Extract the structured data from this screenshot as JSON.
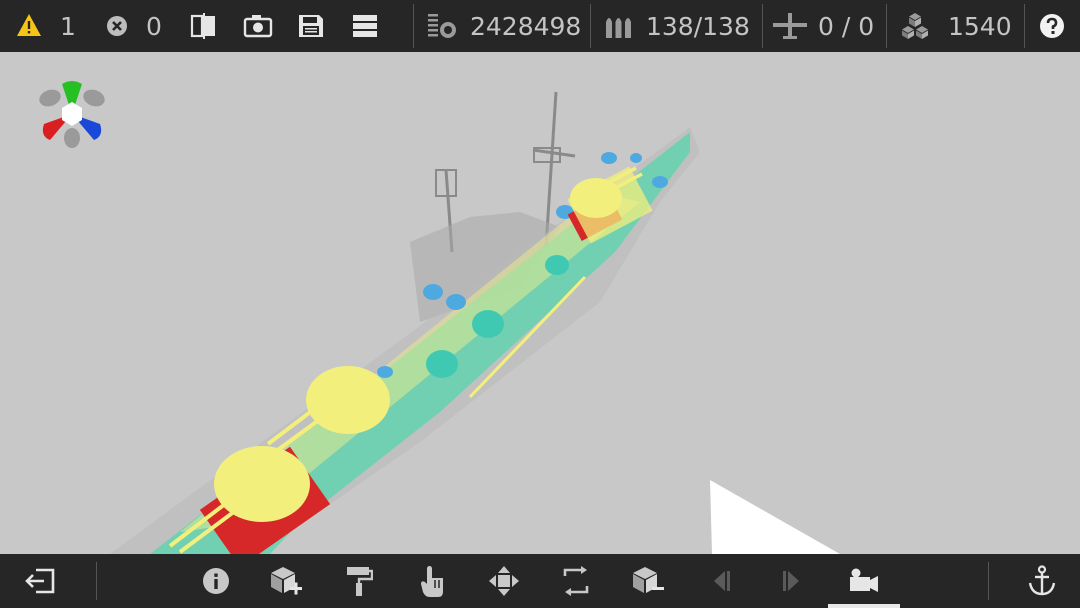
{
  "topbar": {
    "warnings": "1",
    "errors": "0",
    "points": "2428498",
    "ammo": "138/138",
    "planes": "0 / 0",
    "parts": "1540"
  },
  "icons": {
    "warning": "warning-triangle-icon",
    "error": "close-circle-icon",
    "compare": "compare-icon",
    "screenshot": "camera-icon",
    "save": "save-icon",
    "menu": "menu-icon",
    "points": "points-icon",
    "ammo": "ammo-icon",
    "planes": "plane-icon",
    "parts": "blocks-icon",
    "help": "help-icon",
    "exit": "exit-icon",
    "info": "info-icon",
    "add_part": "add-block-icon",
    "paint": "paint-roller-icon",
    "select": "hand-pointer-icon",
    "move": "move-arrows-icon",
    "rotate": "rotate-icon",
    "remove_part": "remove-block-icon",
    "undo": "undo-icon",
    "redo": "redo-icon",
    "camera": "camera-mode-icon",
    "anchor": "anchor-icon"
  },
  "colors": {
    "bar": "#262626",
    "viewport": "#c8c8c8",
    "warning": "#f5c518",
    "hull": "#57d6ae",
    "turret": "#f3ef7c",
    "danger": "#d92020",
    "equipment": "#4ea9e0"
  }
}
